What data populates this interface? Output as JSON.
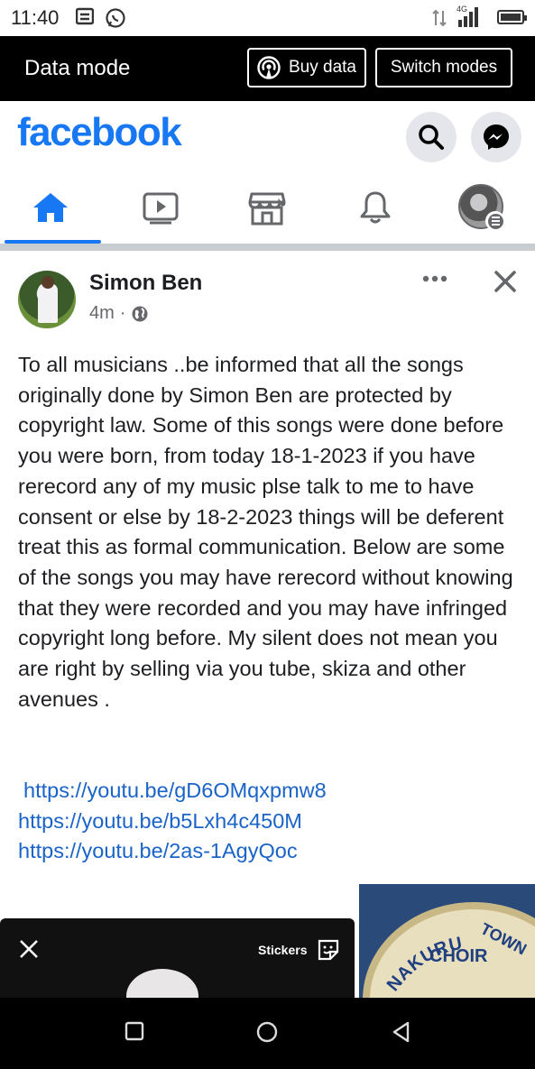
{
  "status_bar": {
    "time": "11:40",
    "network_label": "4G"
  },
  "data_mode_bar": {
    "title": "Data mode",
    "buy_data_label": "Buy data",
    "switch_modes_label": "Switch modes"
  },
  "header": {
    "logo_text": "facebook",
    "brand_color": "#1877f2"
  },
  "tabs": [
    {
      "name": "home",
      "icon": "home-icon",
      "active": true
    },
    {
      "name": "watch",
      "icon": "video-icon",
      "active": false
    },
    {
      "name": "marketplace",
      "icon": "store-icon",
      "active": false
    },
    {
      "name": "notifications",
      "icon": "bell-icon",
      "active": false
    },
    {
      "name": "menu",
      "icon": "profile-menu-icon",
      "active": false
    }
  ],
  "post": {
    "author": "Simon Ben",
    "time": "4m",
    "separator": "·",
    "privacy_icon": "globe-icon",
    "body": "To all musicians ..be informed that all the songs originally done by Simon Ben are protected by copyright law. Some of this songs were done before you were born, from today 18-1-2023 if you have rerecord any of my music plse talk to me to have consent or else by 18-2-2023 things will be deferent treat this as formal communication. Below are some of the songs you may have rerecord without knowing that they were recorded and you may have infringed copyright long before. My silent does not mean you are right by selling via you tube, skiza and other avenues .",
    "links": [
      "https://youtu.be/gD6OMqxpmw8",
      "https://youtu.be/b5Lxh4c450M",
      "https://youtu.be/2as-1AgyQoc"
    ]
  },
  "media": {
    "left_stickers_label": "Stickers",
    "right_image_text_1": "NAKURU",
    "right_image_text_2": "TOWN",
    "right_image_text_3": "CHOIR"
  }
}
